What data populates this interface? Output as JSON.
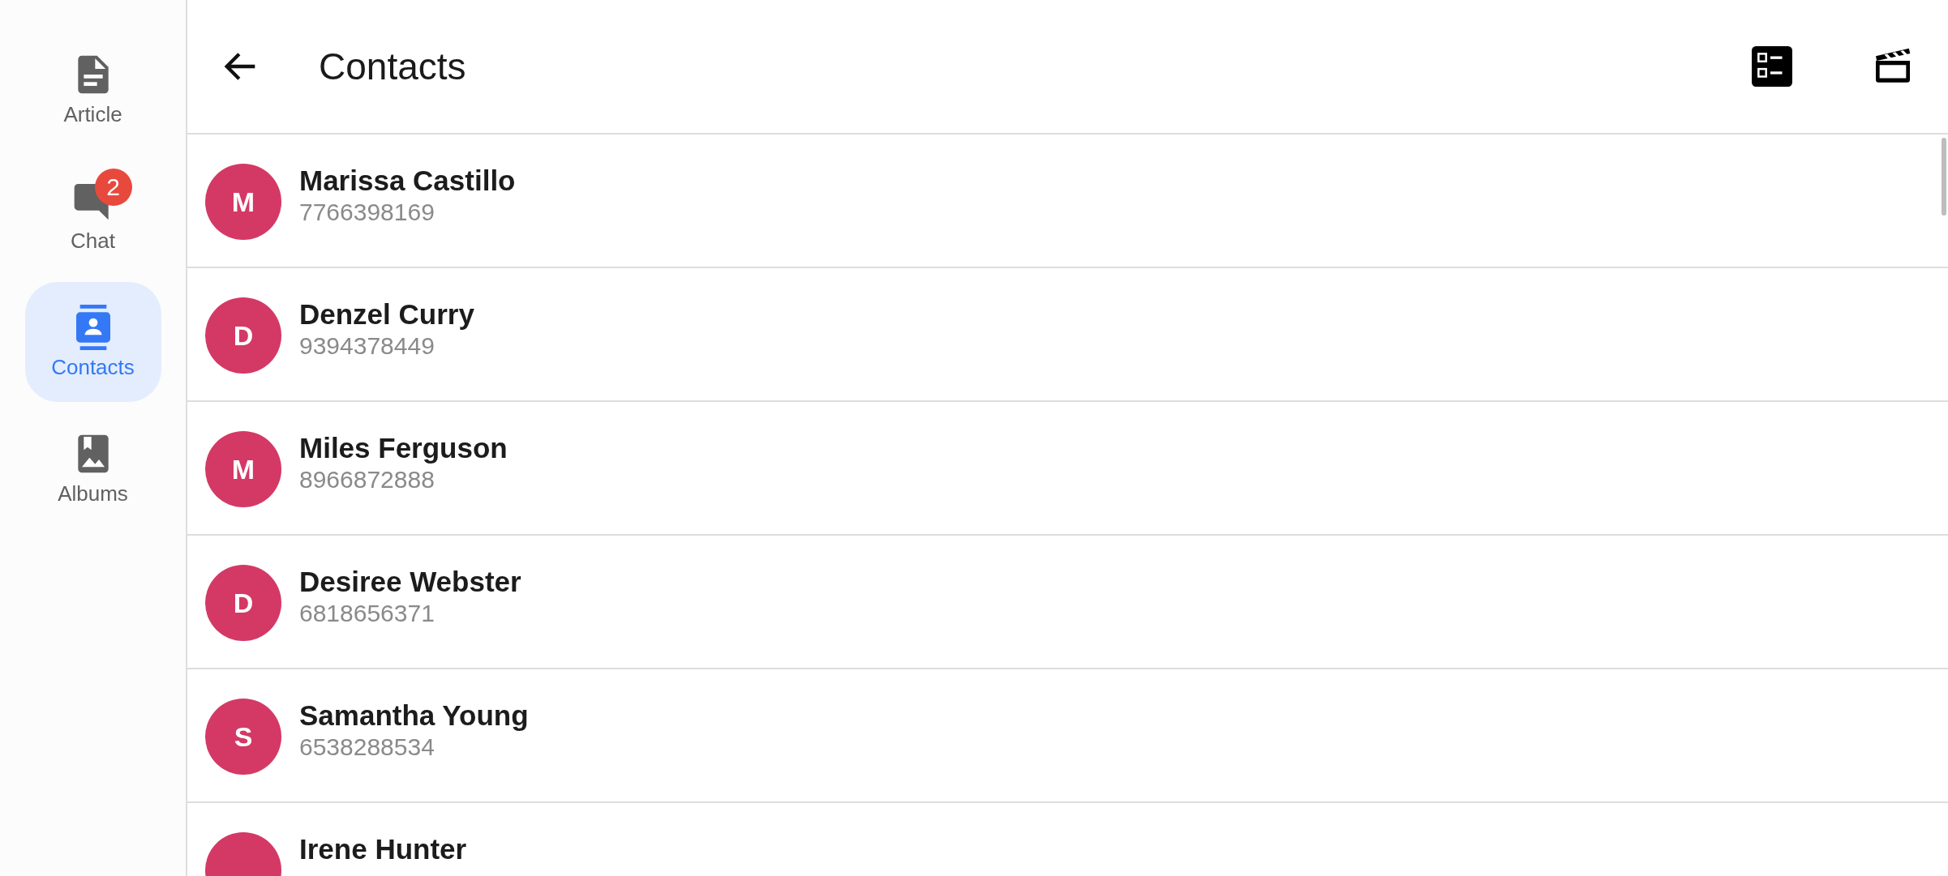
{
  "sidebar": {
    "items": [
      {
        "kind": "article",
        "label": "Article",
        "selected": false
      },
      {
        "kind": "chat",
        "label": "Chat",
        "selected": false,
        "badge": "2"
      },
      {
        "kind": "contacts",
        "label": "Contacts",
        "selected": true
      },
      {
        "kind": "albums",
        "label": "Albums",
        "selected": false
      }
    ]
  },
  "header": {
    "title": "Contacts"
  },
  "contacts": [
    {
      "initial": "M",
      "name": "Marissa Castillo",
      "phone": "7766398169"
    },
    {
      "initial": "D",
      "name": "Denzel Curry",
      "phone": "9394378449"
    },
    {
      "initial": "M",
      "name": "Miles Ferguson",
      "phone": "8966872888"
    },
    {
      "initial": "D",
      "name": "Desiree Webster",
      "phone": "6818656371"
    },
    {
      "initial": "S",
      "name": "Samantha Young",
      "phone": "6538288534"
    },
    {
      "name": "Irene Hunter"
    }
  ]
}
